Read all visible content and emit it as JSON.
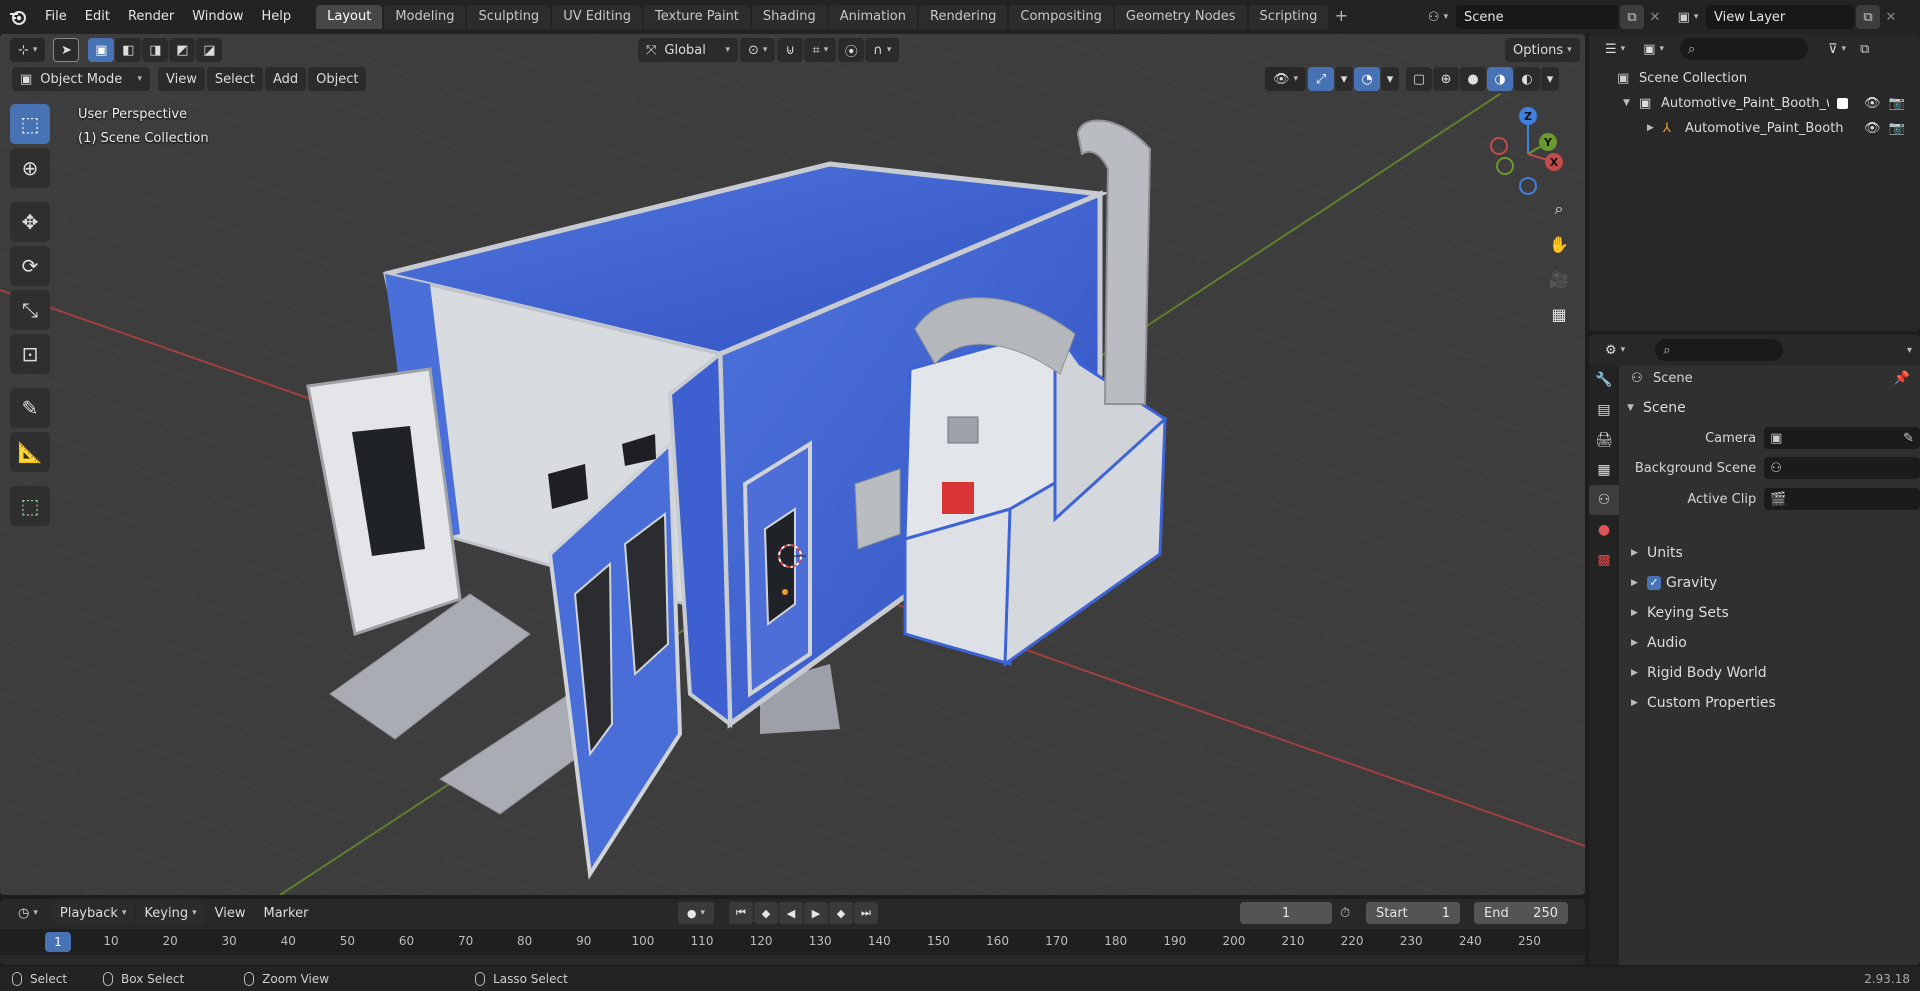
{
  "menus": [
    "File",
    "Edit",
    "Render",
    "Window",
    "Help"
  ],
  "workspaces": [
    "Layout",
    "Modeling",
    "Sculpting",
    "UV Editing",
    "Texture Paint",
    "Shading",
    "Animation",
    "Rendering",
    "Compositing",
    "Geometry Nodes",
    "Scripting"
  ],
  "active_workspace": "Layout",
  "scene_name": "Scene",
  "view_layer": "View Layer",
  "viewport": {
    "transform_orientation": "Global",
    "options_label": "Options",
    "mode": "Object Mode",
    "header_menus": [
      "View",
      "Select",
      "Add",
      "Object"
    ],
    "overlay_title": "User Perspective",
    "overlay_collection": "(1) Scene Collection",
    "gizmo_axes": {
      "x": "X",
      "y": "Y",
      "z": "Z"
    }
  },
  "tools": [
    "select-box",
    "cursor",
    "move",
    "rotate",
    "scale",
    "transform",
    "annotate",
    "measure",
    "add-cube"
  ],
  "outliner": {
    "root": "Scene Collection",
    "rows": [
      {
        "label": "Automotive_Paint_Booth_witl",
        "kind": "collection"
      },
      {
        "label": "Automotive_Paint_Booth",
        "kind": "object"
      }
    ]
  },
  "properties": {
    "context_title": "Scene",
    "panel_scene": "Scene",
    "fields": [
      {
        "label": "Camera"
      },
      {
        "label": "Background Scene"
      },
      {
        "label": "Active Clip"
      }
    ],
    "subpanels": [
      "Units",
      "Gravity",
      "Keying Sets",
      "Audio",
      "Rigid Body World",
      "Custom Properties"
    ],
    "gravity_checked": true
  },
  "timeline": {
    "menus": [
      "Playback",
      "Keying",
      "View",
      "Marker"
    ],
    "current_frame": "1",
    "start_label": "Start",
    "start_value": "1",
    "end_label": "End",
    "end_value": "250",
    "ruler_ticks": [
      "1",
      "10",
      "20",
      "30",
      "40",
      "50",
      "60",
      "70",
      "80",
      "90",
      "100",
      "110",
      "120",
      "130",
      "140",
      "150",
      "160",
      "170",
      "180",
      "190",
      "200",
      "210",
      "220",
      "230",
      "240",
      "250"
    ]
  },
  "status": {
    "select": "Select",
    "box_select": "Box Select",
    "zoom_view": "Zoom View",
    "lasso_select": "Lasso Select",
    "version": "2.93.18"
  },
  "colors": {
    "accent": "#4772b3",
    "booth_blue": "#3b5fd0",
    "axis_x": "#c24a4a",
    "axis_y": "#6a9a2e",
    "axis_z": "#3f80e0"
  }
}
